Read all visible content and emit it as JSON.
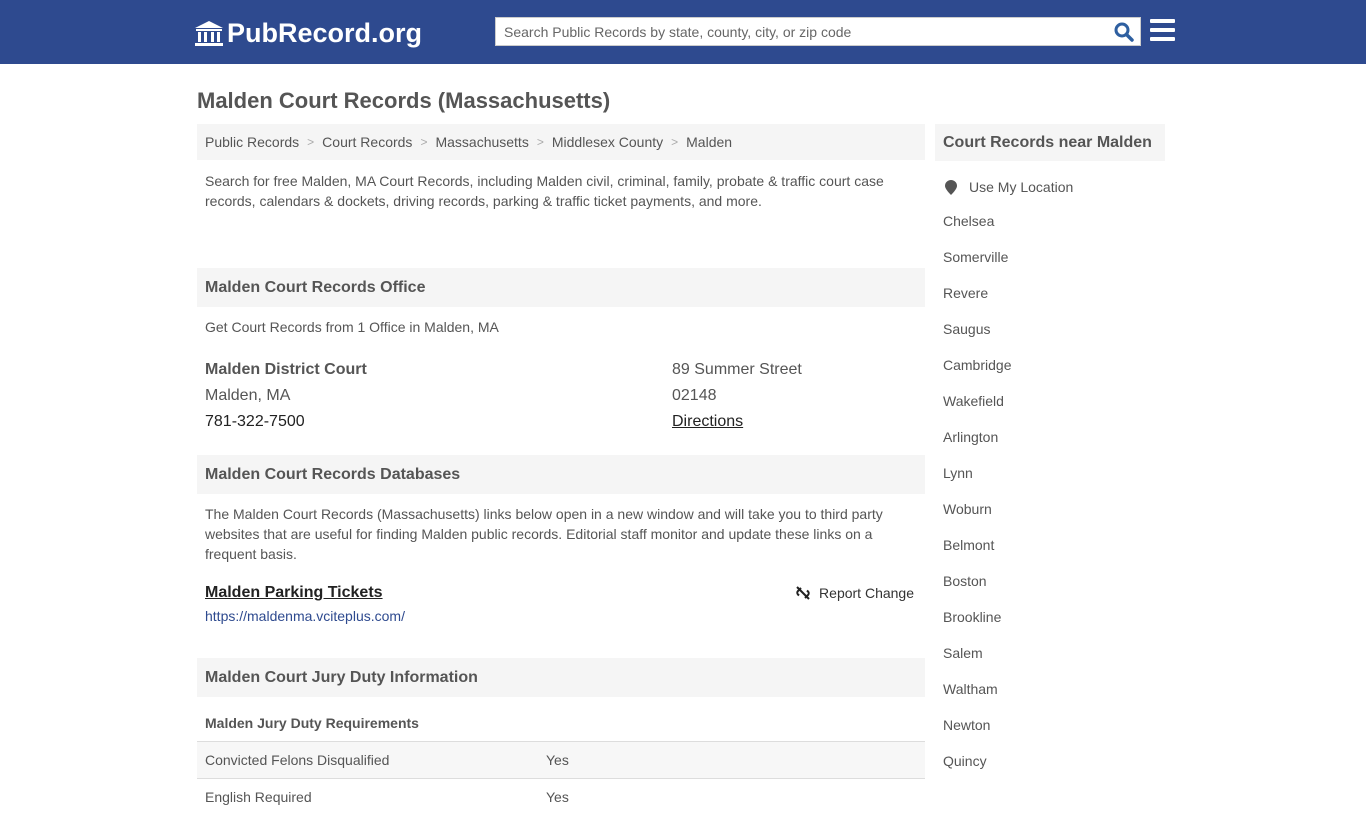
{
  "header": {
    "logo_text": "PubRecord.org",
    "search_placeholder": "Search Public Records by state, county, city, or zip code",
    "colors": {
      "brand": "#2e4a8f",
      "search_icon": "#2e5fa0"
    }
  },
  "page": {
    "title": "Malden Court Records (Massachusetts)"
  },
  "breadcrumb": [
    {
      "label": "Public Records"
    },
    {
      "label": "Court Records"
    },
    {
      "label": "Massachusetts"
    },
    {
      "label": "Middlesex County"
    },
    {
      "label": "Malden"
    }
  ],
  "breadcrumb_separator": ">",
  "intro": "Search for free Malden, MA Court Records, including Malden civil, criminal, family, probate & traffic court case records, calendars & dockets, driving records, parking & traffic ticket payments, and more.",
  "office_section": {
    "heading": "Malden Court Records Office",
    "subtext": "Get Court Records from 1 Office in Malden, MA",
    "office": {
      "name": "Malden District Court",
      "city_state": "Malden, MA",
      "phone": "781-322-7500",
      "street": "89 Summer Street",
      "zip": "02148",
      "directions_label": "Directions"
    }
  },
  "databases_section": {
    "heading": "Malden Court Records Databases",
    "text": "The Malden Court Records (Massachusetts) links below open in a new window and will take you to third party websites that are useful for finding Malden public records. Editorial staff monitor and update these links on a frequent basis.",
    "links": [
      {
        "title": "Malden Parking Tickets",
        "url": "https://maldenma.vciteplus.com/",
        "report_label": "Report Change"
      }
    ]
  },
  "jury_section": {
    "heading": "Malden Court Jury Duty Information",
    "subheading": "Malden Jury Duty Requirements",
    "rows": [
      {
        "label": "Convicted Felons Disqualified",
        "value": "Yes"
      },
      {
        "label": "English Required",
        "value": "Yes"
      }
    ]
  },
  "sidebar": {
    "heading": "Court Records near Malden",
    "use_location_label": "Use My Location",
    "cities": [
      "Chelsea",
      "Somerville",
      "Revere",
      "Saugus",
      "Cambridge",
      "Wakefield",
      "Arlington",
      "Lynn",
      "Woburn",
      "Belmont",
      "Boston",
      "Brookline",
      "Salem",
      "Waltham",
      "Newton",
      "Quincy"
    ]
  }
}
